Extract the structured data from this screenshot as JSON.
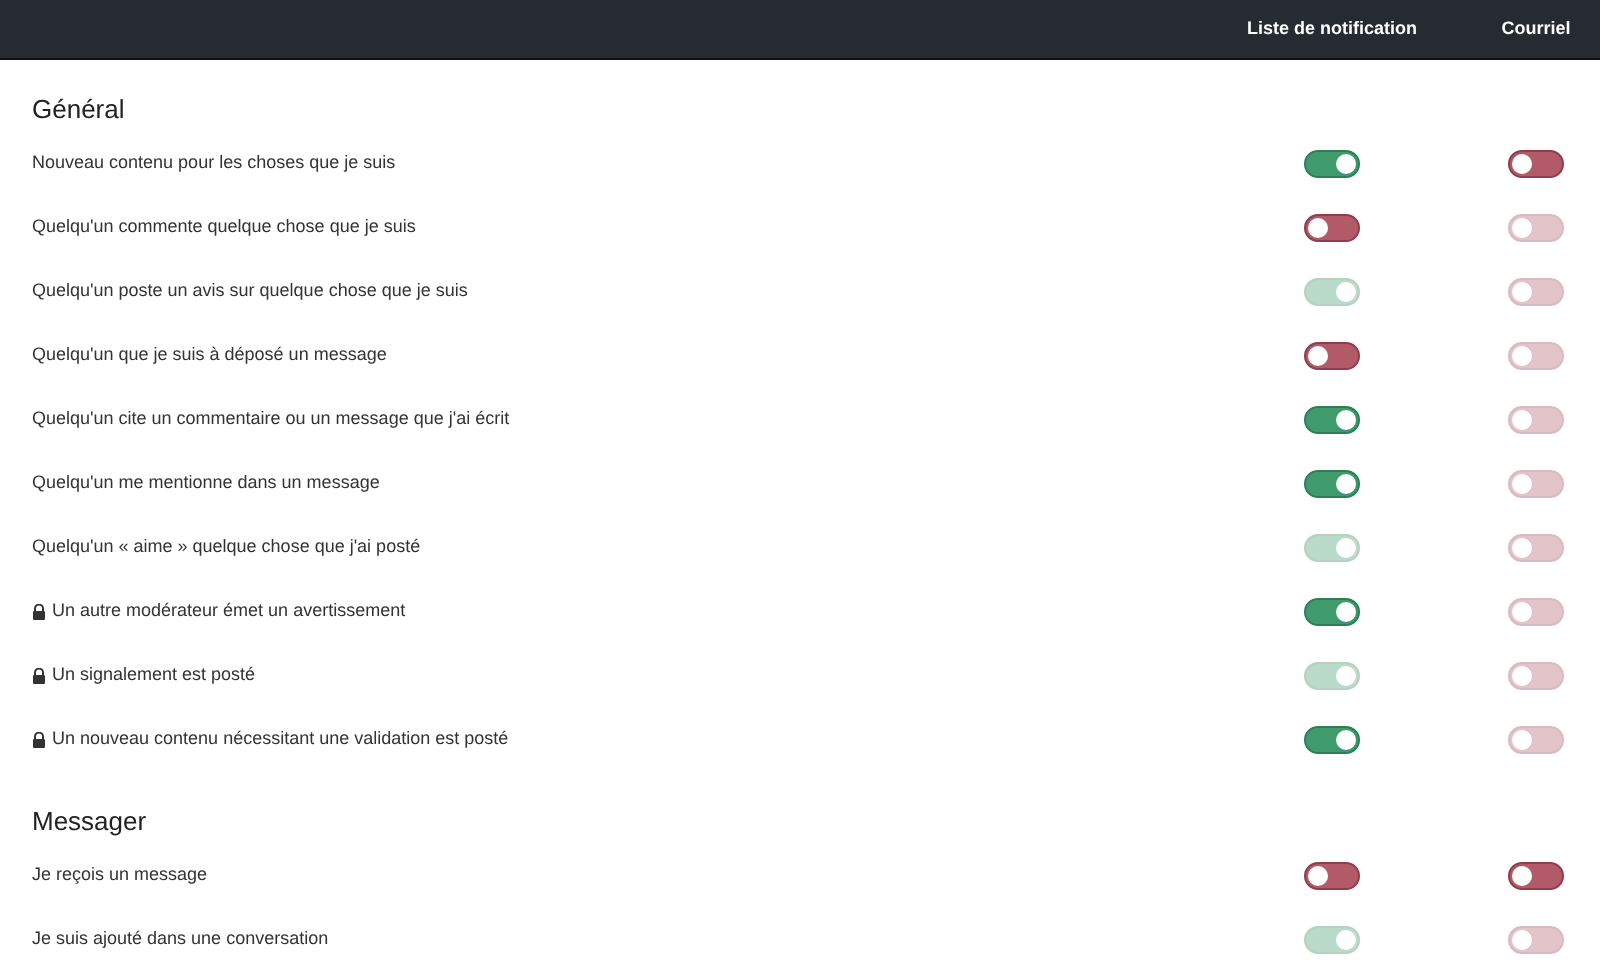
{
  "header": {
    "columns": [
      "Liste de notification",
      "Courriel"
    ]
  },
  "sections": [
    {
      "title": "Général",
      "rows": [
        {
          "label": "Nouveau contenu pour les choses que je suis",
          "locked": false,
          "notify": {
            "on": true,
            "disabled": false
          },
          "email": {
            "on": false,
            "disabled": false
          }
        },
        {
          "label": "Quelqu'un commente quelque chose que je suis",
          "locked": false,
          "notify": {
            "on": false,
            "disabled": false
          },
          "email": {
            "on": false,
            "disabled": true
          }
        },
        {
          "label": "Quelqu'un poste un avis sur quelque chose que je suis",
          "locked": false,
          "notify": {
            "on": true,
            "disabled": true
          },
          "email": {
            "on": false,
            "disabled": true
          }
        },
        {
          "label": "Quelqu'un que je suis à déposé un message",
          "locked": false,
          "notify": {
            "on": false,
            "disabled": false
          },
          "email": {
            "on": false,
            "disabled": true
          }
        },
        {
          "label": "Quelqu'un cite un commentaire ou un message que j'ai écrit",
          "locked": false,
          "notify": {
            "on": true,
            "disabled": false
          },
          "email": {
            "on": false,
            "disabled": true
          }
        },
        {
          "label": "Quelqu'un me mentionne dans un message",
          "locked": false,
          "notify": {
            "on": true,
            "disabled": false
          },
          "email": {
            "on": false,
            "disabled": true
          }
        },
        {
          "label": "Quelqu'un « aime » quelque chose que j'ai posté",
          "locked": false,
          "notify": {
            "on": true,
            "disabled": true
          },
          "email": {
            "on": false,
            "disabled": true
          }
        },
        {
          "label": "Un autre modérateur émet un avertissement",
          "locked": true,
          "notify": {
            "on": true,
            "disabled": false
          },
          "email": {
            "on": false,
            "disabled": true
          }
        },
        {
          "label": "Un signalement est posté",
          "locked": true,
          "notify": {
            "on": true,
            "disabled": true
          },
          "email": {
            "on": false,
            "disabled": true
          }
        },
        {
          "label": "Un nouveau contenu nécessitant une validation est posté",
          "locked": true,
          "notify": {
            "on": true,
            "disabled": false
          },
          "email": {
            "on": false,
            "disabled": true
          }
        }
      ]
    },
    {
      "title": "Messager",
      "rows": [
        {
          "label": "Je reçois un message",
          "locked": false,
          "notify": {
            "on": false,
            "disabled": false
          },
          "email": {
            "on": false,
            "disabled": false
          }
        },
        {
          "label": "Je suis ajouté dans une conversation",
          "locked": false,
          "notify": {
            "on": true,
            "disabled": true
          },
          "email": {
            "on": false,
            "disabled": true
          }
        }
      ]
    }
  ]
}
